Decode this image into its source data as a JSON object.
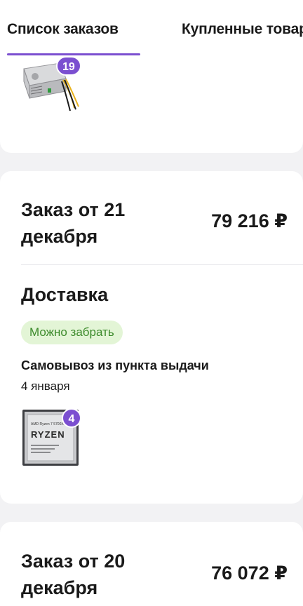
{
  "tabs": [
    {
      "label": "Список заказов",
      "active": true
    },
    {
      "label": "Купленные товары",
      "active": false
    }
  ],
  "accent_color": "#7b4fd0",
  "orders": [
    {
      "item_count": "19",
      "item_image": "power-supply-unit-photo"
    },
    {
      "title": "Заказ от 21 декабря",
      "total": "79 216 ₽",
      "delivery_heading": "Доставка",
      "status": "Можно забрать",
      "method": "Самовывоз из пункта выдачи",
      "date": "4 января",
      "item_count": "4",
      "item_image": "amd-ryzen-cpu-photo",
      "item_image_text": [
        "AMD Ryzen 7 5700X",
        "RYZEN"
      ]
    },
    {
      "title": "Заказ от 20 декабря",
      "total": "76 072 ₽"
    }
  ]
}
